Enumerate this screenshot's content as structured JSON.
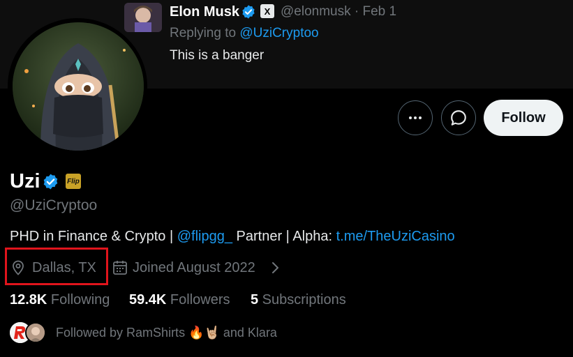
{
  "tweet": {
    "author_name": "Elon Musk",
    "verified_icon": "verified-badge-icon",
    "affiliate_badge": "X",
    "meta": "@elonmusk · Feb 1",
    "replying_prefix": "Replying to ",
    "replying_handle": "@UziCryptoo",
    "text": "This is a banger"
  },
  "actions": {
    "more_icon": "more-horizontal-icon",
    "message_icon": "message-icon",
    "follow_label": "Follow"
  },
  "profile": {
    "name": "Uzi",
    "affiliate_badge": "Flip",
    "handle": "@UziCryptoo",
    "bio_prefix": "PHD in Finance & Crypto | ",
    "bio_mention": "@flipgg_",
    "bio_middle": " Partner | Alpha: ",
    "bio_link": "t.me/TheUziCasino",
    "location": "Dallas, TX",
    "joined": "Joined August 2022",
    "stats": {
      "following_count": "12.8K",
      "following_label": " Following",
      "followers_count": "59.4K",
      "followers_label": " Followers",
      "subscriptions_count": "5",
      "subscriptions_label": " Subscriptions"
    },
    "followed_by": "Followed by RamShirts 🔥🤘🏼 and Klara"
  },
  "colors": {
    "accent": "#1d9bf0",
    "highlight_box": "#e0141c",
    "background": "#000000",
    "muted_text": "#71767b"
  }
}
